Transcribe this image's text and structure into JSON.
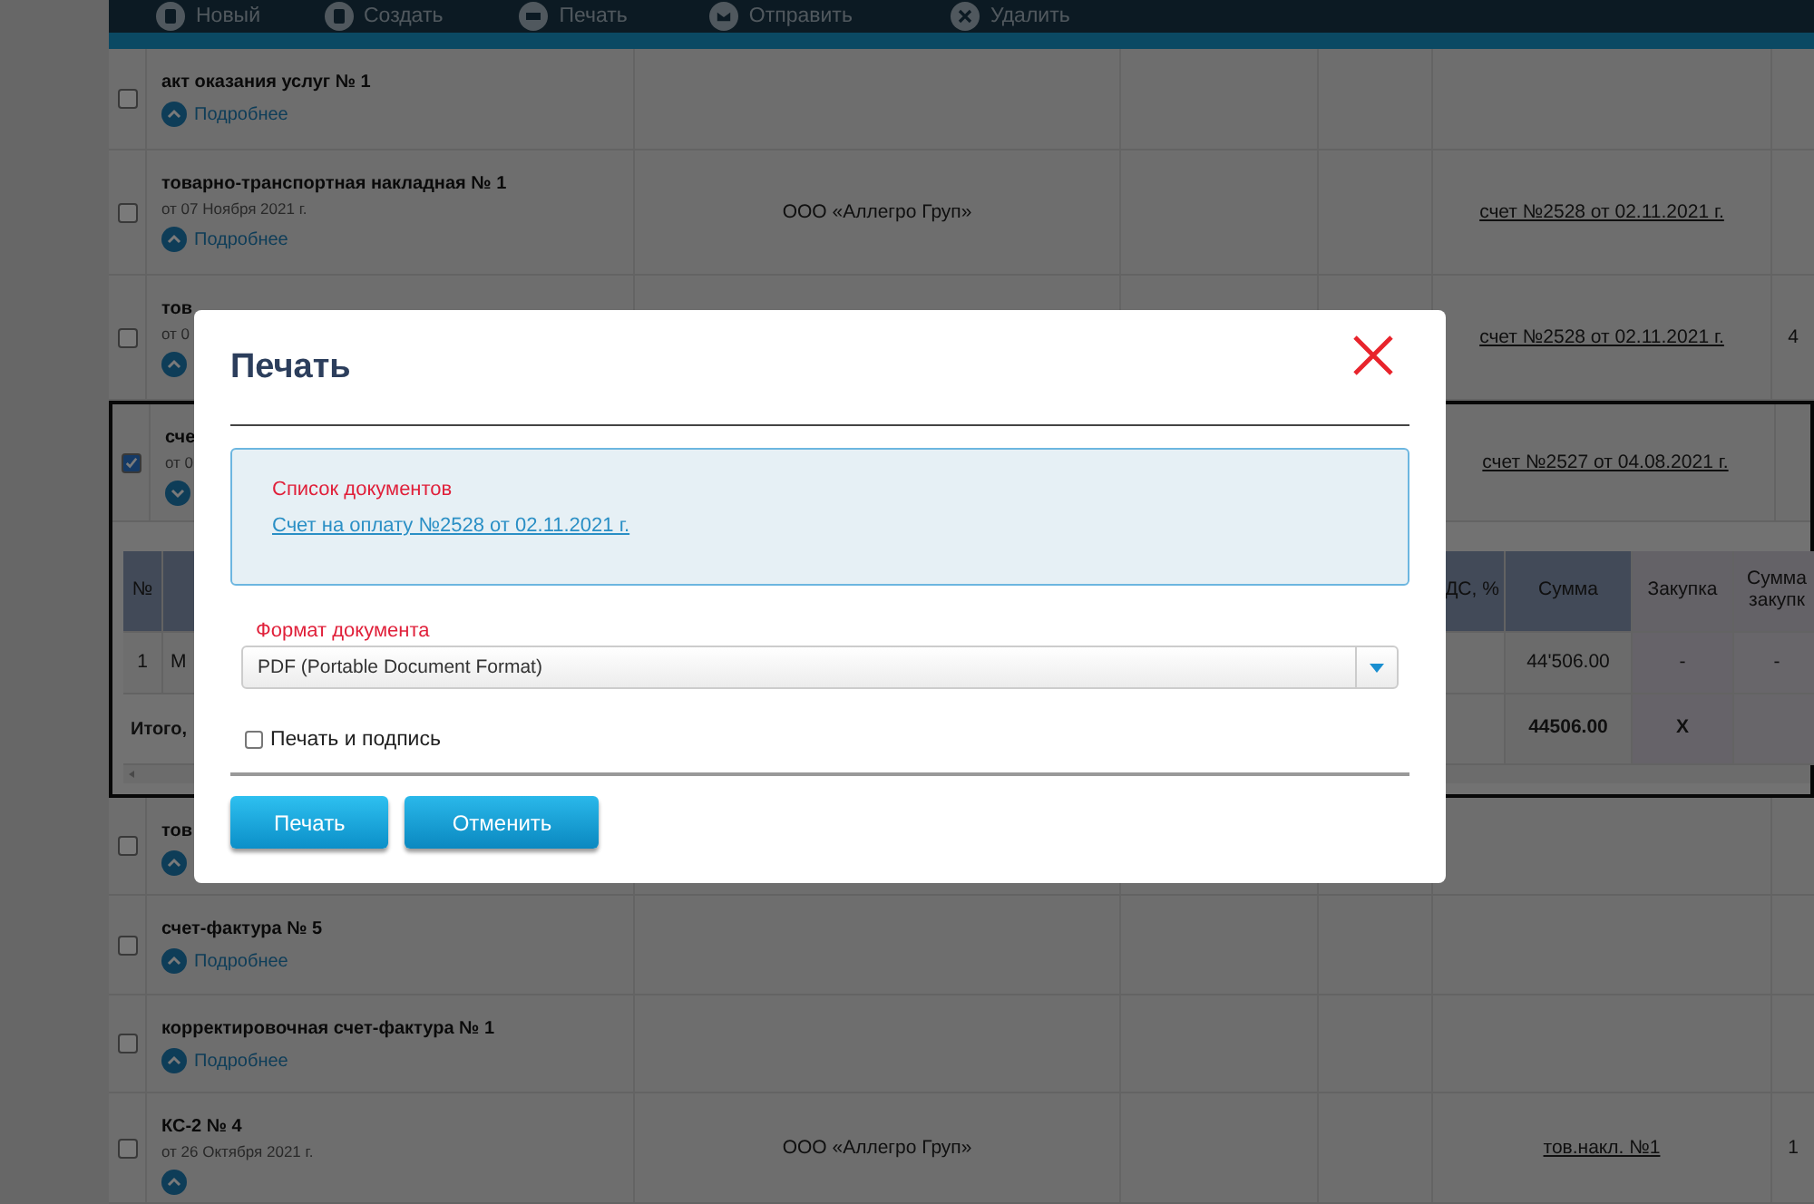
{
  "toolbar": [
    {
      "label": "Новый",
      "kind": "new"
    },
    {
      "label": "Создать",
      "kind": "create"
    },
    {
      "label": "Печать",
      "kind": "print"
    },
    {
      "label": "Отправить",
      "kind": "send"
    },
    {
      "label": "Удалить",
      "kind": "delete"
    }
  ],
  "rows": [
    {
      "title": "акт оказания услуг № 1",
      "checked": false,
      "expanded": false,
      "details": "Подробнее"
    },
    {
      "title": "товарно-транспортная накладная № 1",
      "date": "от 07 Ноября 2021 г.",
      "checked": false,
      "expanded": false,
      "details": "Подробнее",
      "column_3": "ООО «Аллегро Груп»",
      "column_6": "счет №2528 от 02.11.2021 г."
    },
    {
      "title": "тов",
      "date": "от 0",
      "checked": false,
      "expanded": false,
      "column_6": "счет №2528 от 02.11.2021 г.",
      "column_7": "4"
    },
    {
      "title": "сче",
      "date": "от 0",
      "checked": true,
      "expanded": true,
      "column_6": "счет №2527 от 04.08.2021 г.",
      "subtable": {
        "header": {
          "no": "№",
          "vat": "ДС, %",
          "sum": "Сумма",
          "purchase": "Закупка",
          "purchase_sum": "Сумма закупк"
        },
        "rows": [
          {
            "kind": "item",
            "no": "1",
            "name": "М",
            "sum": "44'506.00",
            "purchase": "-",
            "purchase_sum": "-"
          },
          {
            "kind": "total",
            "no": "Итого,",
            "sum": "44506.00",
            "purchase": "X"
          }
        ]
      }
    },
    {
      "title": "тов",
      "checked": false,
      "expanded": false
    },
    {
      "title": "счет-фактура № 5",
      "checked": false,
      "expanded": false,
      "details": "Подробнее"
    },
    {
      "title": "корректировочная счет-фактура № 1",
      "checked": false,
      "expanded": false,
      "details": "Подробнее"
    },
    {
      "title": "КС-2 № 4",
      "date": "от 26 Октября 2021 г.",
      "checked": false,
      "expanded": false,
      "column_3": "ООО «Аллегро Груп»",
      "column_6": "тов.накл. №1",
      "column_7": "1"
    }
  ],
  "modal": {
    "title": "Печать",
    "documents": {
      "label": "Список документов",
      "items": [
        "Счет на оплату №2528 от 02.11.2021 г."
      ]
    },
    "format": {
      "label": "Формат документа",
      "value": "PDF (Portable Document Format)"
    },
    "sign": {
      "label": "Печать и подпись",
      "checked": false
    },
    "buttons": [
      {
        "label": "Печать",
        "kind": "primary"
      },
      {
        "label": "Отменить",
        "kind": "secondary"
      }
    ]
  }
}
